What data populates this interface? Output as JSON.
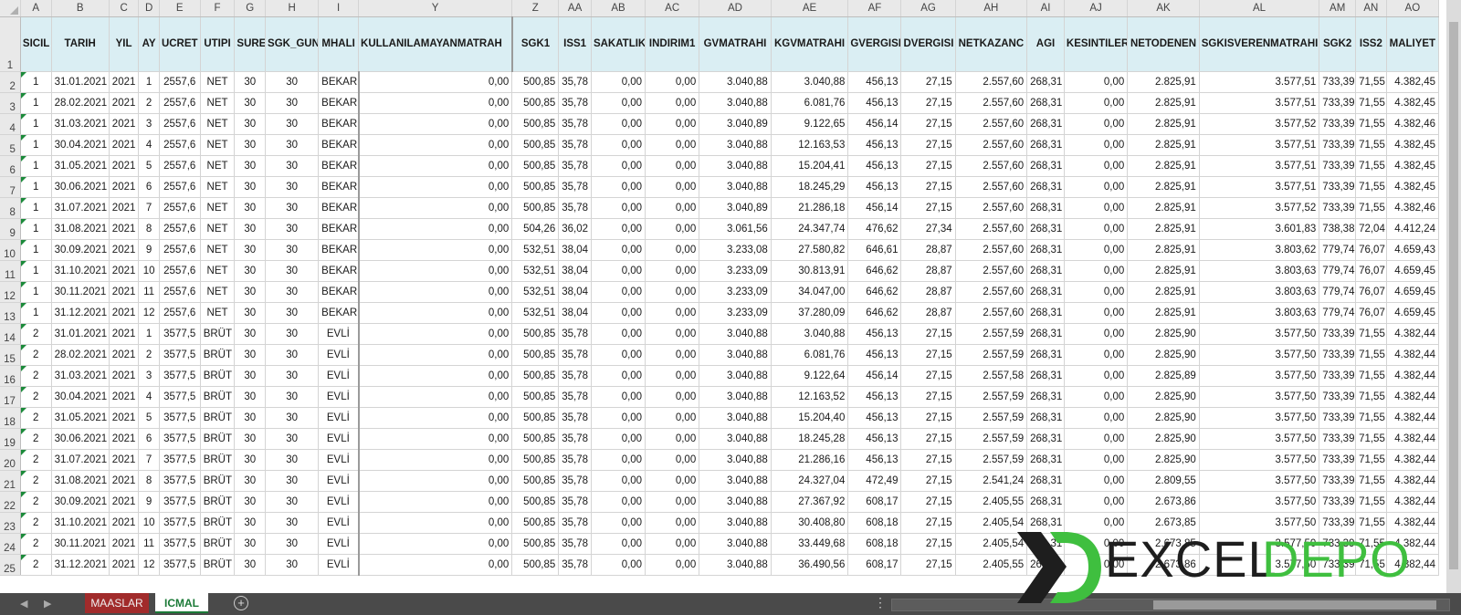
{
  "columns": [
    "A",
    "B",
    "C",
    "D",
    "E",
    "F",
    "G",
    "H",
    "I",
    "Y",
    "Z",
    "AA",
    "AB",
    "AC",
    "AD",
    "AE",
    "AF",
    "AG",
    "AH",
    "AI",
    "AJ",
    "AK",
    "AL",
    "AM",
    "AN",
    "AO"
  ],
  "headers": [
    "SICIL",
    "TARIH",
    "YIL",
    "AY",
    "UCRET",
    "UTIPI",
    "SURE",
    "SGK_GUN",
    "MHALI",
    "KULLANILAMAYANMATRAH",
    "SGK1",
    "ISS1",
    "SAKATLIK",
    "INDIRIM1",
    "GVMATRAHI",
    "KGVMATRAHI",
    "GVERGISI",
    "DVERGISI",
    "NETKAZANC",
    "AGI",
    "KESINTILER",
    "NETODENEN",
    "SGKISVERENMATRAHI",
    "SGK2",
    "ISS2",
    "MALIYET"
  ],
  "rows": [
    [
      "1",
      "31.01.2021",
      "2021",
      "1",
      "2557,6",
      "NET",
      "30",
      "30",
      "BEKAR",
      "0,00",
      "500,85",
      "35,78",
      "0,00",
      "0,00",
      "3.040,88",
      "3.040,88",
      "456,13",
      "27,15",
      "2.557,60",
      "268,31",
      "0,00",
      "2.825,91",
      "3.577,51",
      "733,39",
      "71,55",
      "4.382,45"
    ],
    [
      "1",
      "28.02.2021",
      "2021",
      "2",
      "2557,6",
      "NET",
      "30",
      "30",
      "BEKAR",
      "0,00",
      "500,85",
      "35,78",
      "0,00",
      "0,00",
      "3.040,88",
      "6.081,76",
      "456,13",
      "27,15",
      "2.557,60",
      "268,31",
      "0,00",
      "2.825,91",
      "3.577,51",
      "733,39",
      "71,55",
      "4.382,45"
    ],
    [
      "1",
      "31.03.2021",
      "2021",
      "3",
      "2557,6",
      "NET",
      "30",
      "30",
      "BEKAR",
      "0,00",
      "500,85",
      "35,78",
      "0,00",
      "0,00",
      "3.040,89",
      "9.122,65",
      "456,14",
      "27,15",
      "2.557,60",
      "268,31",
      "0,00",
      "2.825,91",
      "3.577,52",
      "733,39",
      "71,55",
      "4.382,46"
    ],
    [
      "1",
      "30.04.2021",
      "2021",
      "4",
      "2557,6",
      "NET",
      "30",
      "30",
      "BEKAR",
      "0,00",
      "500,85",
      "35,78",
      "0,00",
      "0,00",
      "3.040,88",
      "12.163,53",
      "456,13",
      "27,15",
      "2.557,60",
      "268,31",
      "0,00",
      "2.825,91",
      "3.577,51",
      "733,39",
      "71,55",
      "4.382,45"
    ],
    [
      "1",
      "31.05.2021",
      "2021",
      "5",
      "2557,6",
      "NET",
      "30",
      "30",
      "BEKAR",
      "0,00",
      "500,85",
      "35,78",
      "0,00",
      "0,00",
      "3.040,88",
      "15.204,41",
      "456,13",
      "27,15",
      "2.557,60",
      "268,31",
      "0,00",
      "2.825,91",
      "3.577,51",
      "733,39",
      "71,55",
      "4.382,45"
    ],
    [
      "1",
      "30.06.2021",
      "2021",
      "6",
      "2557,6",
      "NET",
      "30",
      "30",
      "BEKAR",
      "0,00",
      "500,85",
      "35,78",
      "0,00",
      "0,00",
      "3.040,88",
      "18.245,29",
      "456,13",
      "27,15",
      "2.557,60",
      "268,31",
      "0,00",
      "2.825,91",
      "3.577,51",
      "733,39",
      "71,55",
      "4.382,45"
    ],
    [
      "1",
      "31.07.2021",
      "2021",
      "7",
      "2557,6",
      "NET",
      "30",
      "30",
      "BEKAR",
      "0,00",
      "500,85",
      "35,78",
      "0,00",
      "0,00",
      "3.040,89",
      "21.286,18",
      "456,14",
      "27,15",
      "2.557,60",
      "268,31",
      "0,00",
      "2.825,91",
      "3.577,52",
      "733,39",
      "71,55",
      "4.382,46"
    ],
    [
      "1",
      "31.08.2021",
      "2021",
      "8",
      "2557,6",
      "NET",
      "30",
      "30",
      "BEKAR",
      "0,00",
      "504,26",
      "36,02",
      "0,00",
      "0,00",
      "3.061,56",
      "24.347,74",
      "476,62",
      "27,34",
      "2.557,60",
      "268,31",
      "0,00",
      "2.825,91",
      "3.601,83",
      "738,38",
      "72,04",
      "4.412,24"
    ],
    [
      "1",
      "30.09.2021",
      "2021",
      "9",
      "2557,6",
      "NET",
      "30",
      "30",
      "BEKAR",
      "0,00",
      "532,51",
      "38,04",
      "0,00",
      "0,00",
      "3.233,08",
      "27.580,82",
      "646,61",
      "28,87",
      "2.557,60",
      "268,31",
      "0,00",
      "2.825,91",
      "3.803,62",
      "779,74",
      "76,07",
      "4.659,43"
    ],
    [
      "1",
      "31.10.2021",
      "2021",
      "10",
      "2557,6",
      "NET",
      "30",
      "30",
      "BEKAR",
      "0,00",
      "532,51",
      "38,04",
      "0,00",
      "0,00",
      "3.233,09",
      "30.813,91",
      "646,62",
      "28,87",
      "2.557,60",
      "268,31",
      "0,00",
      "2.825,91",
      "3.803,63",
      "779,74",
      "76,07",
      "4.659,45"
    ],
    [
      "1",
      "30.11.2021",
      "2021",
      "11",
      "2557,6",
      "NET",
      "30",
      "30",
      "BEKAR",
      "0,00",
      "532,51",
      "38,04",
      "0,00",
      "0,00",
      "3.233,09",
      "34.047,00",
      "646,62",
      "28,87",
      "2.557,60",
      "268,31",
      "0,00",
      "2.825,91",
      "3.803,63",
      "779,74",
      "76,07",
      "4.659,45"
    ],
    [
      "1",
      "31.12.2021",
      "2021",
      "12",
      "2557,6",
      "NET",
      "30",
      "30",
      "BEKAR",
      "0,00",
      "532,51",
      "38,04",
      "0,00",
      "0,00",
      "3.233,09",
      "37.280,09",
      "646,62",
      "28,87",
      "2.557,60",
      "268,31",
      "0,00",
      "2.825,91",
      "3.803,63",
      "779,74",
      "76,07",
      "4.659,45"
    ],
    [
      "2",
      "31.01.2021",
      "2021",
      "1",
      "3577,5",
      "BRÜT",
      "30",
      "30",
      "EVLİ",
      "0,00",
      "500,85",
      "35,78",
      "0,00",
      "0,00",
      "3.040,88",
      "3.040,88",
      "456,13",
      "27,15",
      "2.557,59",
      "268,31",
      "0,00",
      "2.825,90",
      "3.577,50",
      "733,39",
      "71,55",
      "4.382,44"
    ],
    [
      "2",
      "28.02.2021",
      "2021",
      "2",
      "3577,5",
      "BRÜT",
      "30",
      "30",
      "EVLİ",
      "0,00",
      "500,85",
      "35,78",
      "0,00",
      "0,00",
      "3.040,88",
      "6.081,76",
      "456,13",
      "27,15",
      "2.557,59",
      "268,31",
      "0,00",
      "2.825,90",
      "3.577,50",
      "733,39",
      "71,55",
      "4.382,44"
    ],
    [
      "2",
      "31.03.2021",
      "2021",
      "3",
      "3577,5",
      "BRÜT",
      "30",
      "30",
      "EVLİ",
      "0,00",
      "500,85",
      "35,78",
      "0,00",
      "0,00",
      "3.040,88",
      "9.122,64",
      "456,14",
      "27,15",
      "2.557,58",
      "268,31",
      "0,00",
      "2.825,89",
      "3.577,50",
      "733,39",
      "71,55",
      "4.382,44"
    ],
    [
      "2",
      "30.04.2021",
      "2021",
      "4",
      "3577,5",
      "BRÜT",
      "30",
      "30",
      "EVLİ",
      "0,00",
      "500,85",
      "35,78",
      "0,00",
      "0,00",
      "3.040,88",
      "12.163,52",
      "456,13",
      "27,15",
      "2.557,59",
      "268,31",
      "0,00",
      "2.825,90",
      "3.577,50",
      "733,39",
      "71,55",
      "4.382,44"
    ],
    [
      "2",
      "31.05.2021",
      "2021",
      "5",
      "3577,5",
      "BRÜT",
      "30",
      "30",
      "EVLİ",
      "0,00",
      "500,85",
      "35,78",
      "0,00",
      "0,00",
      "3.040,88",
      "15.204,40",
      "456,13",
      "27,15",
      "2.557,59",
      "268,31",
      "0,00",
      "2.825,90",
      "3.577,50",
      "733,39",
      "71,55",
      "4.382,44"
    ],
    [
      "2",
      "30.06.2021",
      "2021",
      "6",
      "3577,5",
      "BRÜT",
      "30",
      "30",
      "EVLİ",
      "0,00",
      "500,85",
      "35,78",
      "0,00",
      "0,00",
      "3.040,88",
      "18.245,28",
      "456,13",
      "27,15",
      "2.557,59",
      "268,31",
      "0,00",
      "2.825,90",
      "3.577,50",
      "733,39",
      "71,55",
      "4.382,44"
    ],
    [
      "2",
      "31.07.2021",
      "2021",
      "7",
      "3577,5",
      "BRÜT",
      "30",
      "30",
      "EVLİ",
      "0,00",
      "500,85",
      "35,78",
      "0,00",
      "0,00",
      "3.040,88",
      "21.286,16",
      "456,13",
      "27,15",
      "2.557,59",
      "268,31",
      "0,00",
      "2.825,90",
      "3.577,50",
      "733,39",
      "71,55",
      "4.382,44"
    ],
    [
      "2",
      "31.08.2021",
      "2021",
      "8",
      "3577,5",
      "BRÜT",
      "30",
      "30",
      "EVLİ",
      "0,00",
      "500,85",
      "35,78",
      "0,00",
      "0,00",
      "3.040,88",
      "24.327,04",
      "472,49",
      "27,15",
      "2.541,24",
      "268,31",
      "0,00",
      "2.809,55",
      "3.577,50",
      "733,39",
      "71,55",
      "4.382,44"
    ],
    [
      "2",
      "30.09.2021",
      "2021",
      "9",
      "3577,5",
      "BRÜT",
      "30",
      "30",
      "EVLİ",
      "0,00",
      "500,85",
      "35,78",
      "0,00",
      "0,00",
      "3.040,88",
      "27.367,92",
      "608,17",
      "27,15",
      "2.405,55",
      "268,31",
      "0,00",
      "2.673,86",
      "3.577,50",
      "733,39",
      "71,55",
      "4.382,44"
    ],
    [
      "2",
      "31.10.2021",
      "2021",
      "10",
      "3577,5",
      "BRÜT",
      "30",
      "30",
      "EVLİ",
      "0,00",
      "500,85",
      "35,78",
      "0,00",
      "0,00",
      "3.040,88",
      "30.408,80",
      "608,18",
      "27,15",
      "2.405,54",
      "268,31",
      "0,00",
      "2.673,85",
      "3.577,50",
      "733,39",
      "71,55",
      "4.382,44"
    ],
    [
      "2",
      "30.11.2021",
      "2021",
      "11",
      "3577,5",
      "BRÜT",
      "30",
      "30",
      "EVLİ",
      "0,00",
      "500,85",
      "35,78",
      "0,00",
      "0,00",
      "3.040,88",
      "33.449,68",
      "608,18",
      "27,15",
      "2.405,54",
      "268,31",
      "0,00",
      "2.673,85",
      "3.577,50",
      "733,39",
      "71,55",
      "4.382,44"
    ],
    [
      "2",
      "31.12.2021",
      "2021",
      "12",
      "3577,5",
      "BRÜT",
      "30",
      "30",
      "EVLİ",
      "0,00",
      "500,85",
      "35,78",
      "0,00",
      "0,00",
      "3.040,88",
      "36.490,56",
      "608,17",
      "27,15",
      "2.405,55",
      "268,31",
      "0,00",
      "2.673,86",
      "3.577,50",
      "733,39",
      "71,55",
      "4.382,44"
    ]
  ],
  "sheet_tabs": [
    {
      "label": "MAASLAR",
      "color": "#a12b2b",
      "active": false
    },
    {
      "label": "ICMAL",
      "color": "#1b7a37",
      "active": true
    }
  ],
  "footer": {
    "add_sheet": "⊕",
    "more": "⋮"
  },
  "watermark": {
    "brand_left": "EXCEL",
    "brand_right": "DEPO",
    "brand_dark": "#1e1e1e",
    "brand_green": "#3fbf3f"
  }
}
